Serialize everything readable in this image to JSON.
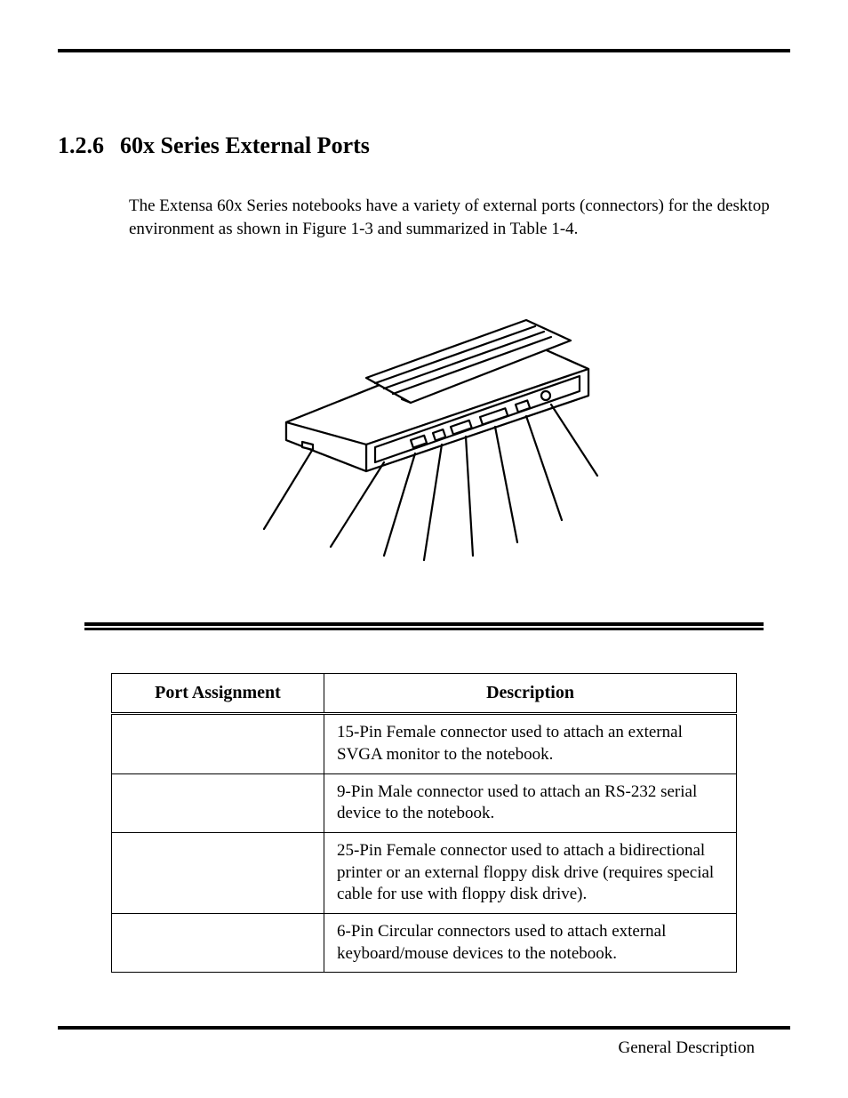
{
  "heading": {
    "number": "1.2.6",
    "title": "60x Series External Ports"
  },
  "intro": "The Extensa 60x Series notebooks have a variety of external ports (connectors) for the desktop environment as shown in Figure 1-3 and summarized in Table 1-4.",
  "table": {
    "headers": {
      "col1": "Port Assignment",
      "col2": "Description"
    },
    "rows": [
      {
        "port": "",
        "desc": "15-Pin Female connector used to attach an external SVGA monitor to the notebook."
      },
      {
        "port": "",
        "desc": "9-Pin Male connector used to attach an RS-232 serial device to the notebook."
      },
      {
        "port": "",
        "desc": "25-Pin Female connector used to attach a bidirectional printer or an external floppy disk drive (requires special cable for use with floppy disk drive)."
      },
      {
        "port": "",
        "desc": "6-Pin Circular connectors used to attach external keyboard/mouse devices to the notebook."
      }
    ]
  },
  "footer": "General Description"
}
